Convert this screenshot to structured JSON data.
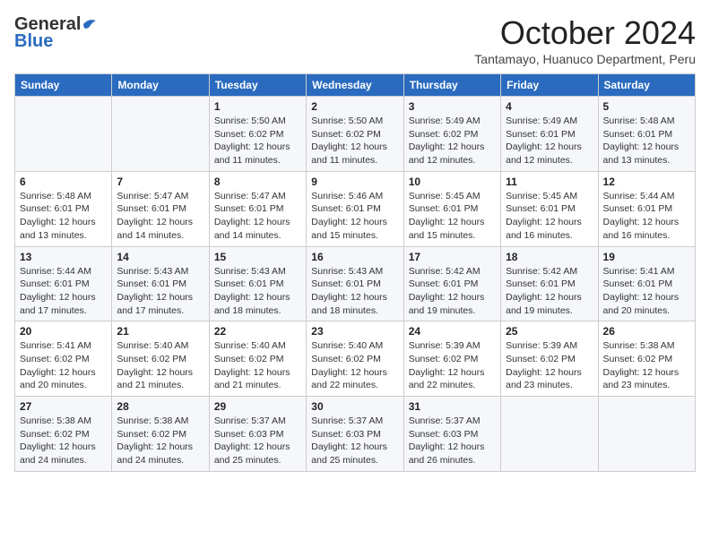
{
  "header": {
    "logo_general": "General",
    "logo_blue": "Blue",
    "month_title": "October 2024",
    "location": "Tantamayo, Huanuco Department, Peru"
  },
  "days_of_week": [
    "Sunday",
    "Monday",
    "Tuesday",
    "Wednesday",
    "Thursday",
    "Friday",
    "Saturday"
  ],
  "weeks": [
    [
      {
        "day": "",
        "sunrise": "",
        "sunset": "",
        "daylight": ""
      },
      {
        "day": "",
        "sunrise": "",
        "sunset": "",
        "daylight": ""
      },
      {
        "day": "1",
        "sunrise": "Sunrise: 5:50 AM",
        "sunset": "Sunset: 6:02 PM",
        "daylight": "Daylight: 12 hours and 11 minutes."
      },
      {
        "day": "2",
        "sunrise": "Sunrise: 5:50 AM",
        "sunset": "Sunset: 6:02 PM",
        "daylight": "Daylight: 12 hours and 11 minutes."
      },
      {
        "day": "3",
        "sunrise": "Sunrise: 5:49 AM",
        "sunset": "Sunset: 6:02 PM",
        "daylight": "Daylight: 12 hours and 12 minutes."
      },
      {
        "day": "4",
        "sunrise": "Sunrise: 5:49 AM",
        "sunset": "Sunset: 6:01 PM",
        "daylight": "Daylight: 12 hours and 12 minutes."
      },
      {
        "day": "5",
        "sunrise": "Sunrise: 5:48 AM",
        "sunset": "Sunset: 6:01 PM",
        "daylight": "Daylight: 12 hours and 13 minutes."
      }
    ],
    [
      {
        "day": "6",
        "sunrise": "Sunrise: 5:48 AM",
        "sunset": "Sunset: 6:01 PM",
        "daylight": "Daylight: 12 hours and 13 minutes."
      },
      {
        "day": "7",
        "sunrise": "Sunrise: 5:47 AM",
        "sunset": "Sunset: 6:01 PM",
        "daylight": "Daylight: 12 hours and 14 minutes."
      },
      {
        "day": "8",
        "sunrise": "Sunrise: 5:47 AM",
        "sunset": "Sunset: 6:01 PM",
        "daylight": "Daylight: 12 hours and 14 minutes."
      },
      {
        "day": "9",
        "sunrise": "Sunrise: 5:46 AM",
        "sunset": "Sunset: 6:01 PM",
        "daylight": "Daylight: 12 hours and 15 minutes."
      },
      {
        "day": "10",
        "sunrise": "Sunrise: 5:45 AM",
        "sunset": "Sunset: 6:01 PM",
        "daylight": "Daylight: 12 hours and 15 minutes."
      },
      {
        "day": "11",
        "sunrise": "Sunrise: 5:45 AM",
        "sunset": "Sunset: 6:01 PM",
        "daylight": "Daylight: 12 hours and 16 minutes."
      },
      {
        "day": "12",
        "sunrise": "Sunrise: 5:44 AM",
        "sunset": "Sunset: 6:01 PM",
        "daylight": "Daylight: 12 hours and 16 minutes."
      }
    ],
    [
      {
        "day": "13",
        "sunrise": "Sunrise: 5:44 AM",
        "sunset": "Sunset: 6:01 PM",
        "daylight": "Daylight: 12 hours and 17 minutes."
      },
      {
        "day": "14",
        "sunrise": "Sunrise: 5:43 AM",
        "sunset": "Sunset: 6:01 PM",
        "daylight": "Daylight: 12 hours and 17 minutes."
      },
      {
        "day": "15",
        "sunrise": "Sunrise: 5:43 AM",
        "sunset": "Sunset: 6:01 PM",
        "daylight": "Daylight: 12 hours and 18 minutes."
      },
      {
        "day": "16",
        "sunrise": "Sunrise: 5:43 AM",
        "sunset": "Sunset: 6:01 PM",
        "daylight": "Daylight: 12 hours and 18 minutes."
      },
      {
        "day": "17",
        "sunrise": "Sunrise: 5:42 AM",
        "sunset": "Sunset: 6:01 PM",
        "daylight": "Daylight: 12 hours and 19 minutes."
      },
      {
        "day": "18",
        "sunrise": "Sunrise: 5:42 AM",
        "sunset": "Sunset: 6:01 PM",
        "daylight": "Daylight: 12 hours and 19 minutes."
      },
      {
        "day": "19",
        "sunrise": "Sunrise: 5:41 AM",
        "sunset": "Sunset: 6:01 PM",
        "daylight": "Daylight: 12 hours and 20 minutes."
      }
    ],
    [
      {
        "day": "20",
        "sunrise": "Sunrise: 5:41 AM",
        "sunset": "Sunset: 6:02 PM",
        "daylight": "Daylight: 12 hours and 20 minutes."
      },
      {
        "day": "21",
        "sunrise": "Sunrise: 5:40 AM",
        "sunset": "Sunset: 6:02 PM",
        "daylight": "Daylight: 12 hours and 21 minutes."
      },
      {
        "day": "22",
        "sunrise": "Sunrise: 5:40 AM",
        "sunset": "Sunset: 6:02 PM",
        "daylight": "Daylight: 12 hours and 21 minutes."
      },
      {
        "day": "23",
        "sunrise": "Sunrise: 5:40 AM",
        "sunset": "Sunset: 6:02 PM",
        "daylight": "Daylight: 12 hours and 22 minutes."
      },
      {
        "day": "24",
        "sunrise": "Sunrise: 5:39 AM",
        "sunset": "Sunset: 6:02 PM",
        "daylight": "Daylight: 12 hours and 22 minutes."
      },
      {
        "day": "25",
        "sunrise": "Sunrise: 5:39 AM",
        "sunset": "Sunset: 6:02 PM",
        "daylight": "Daylight: 12 hours and 23 minutes."
      },
      {
        "day": "26",
        "sunrise": "Sunrise: 5:38 AM",
        "sunset": "Sunset: 6:02 PM",
        "daylight": "Daylight: 12 hours and 23 minutes."
      }
    ],
    [
      {
        "day": "27",
        "sunrise": "Sunrise: 5:38 AM",
        "sunset": "Sunset: 6:02 PM",
        "daylight": "Daylight: 12 hours and 24 minutes."
      },
      {
        "day": "28",
        "sunrise": "Sunrise: 5:38 AM",
        "sunset": "Sunset: 6:02 PM",
        "daylight": "Daylight: 12 hours and 24 minutes."
      },
      {
        "day": "29",
        "sunrise": "Sunrise: 5:37 AM",
        "sunset": "Sunset: 6:03 PM",
        "daylight": "Daylight: 12 hours and 25 minutes."
      },
      {
        "day": "30",
        "sunrise": "Sunrise: 5:37 AM",
        "sunset": "Sunset: 6:03 PM",
        "daylight": "Daylight: 12 hours and 25 minutes."
      },
      {
        "day": "31",
        "sunrise": "Sunrise: 5:37 AM",
        "sunset": "Sunset: 6:03 PM",
        "daylight": "Daylight: 12 hours and 26 minutes."
      },
      {
        "day": "",
        "sunrise": "",
        "sunset": "",
        "daylight": ""
      },
      {
        "day": "",
        "sunrise": "",
        "sunset": "",
        "daylight": ""
      }
    ]
  ]
}
